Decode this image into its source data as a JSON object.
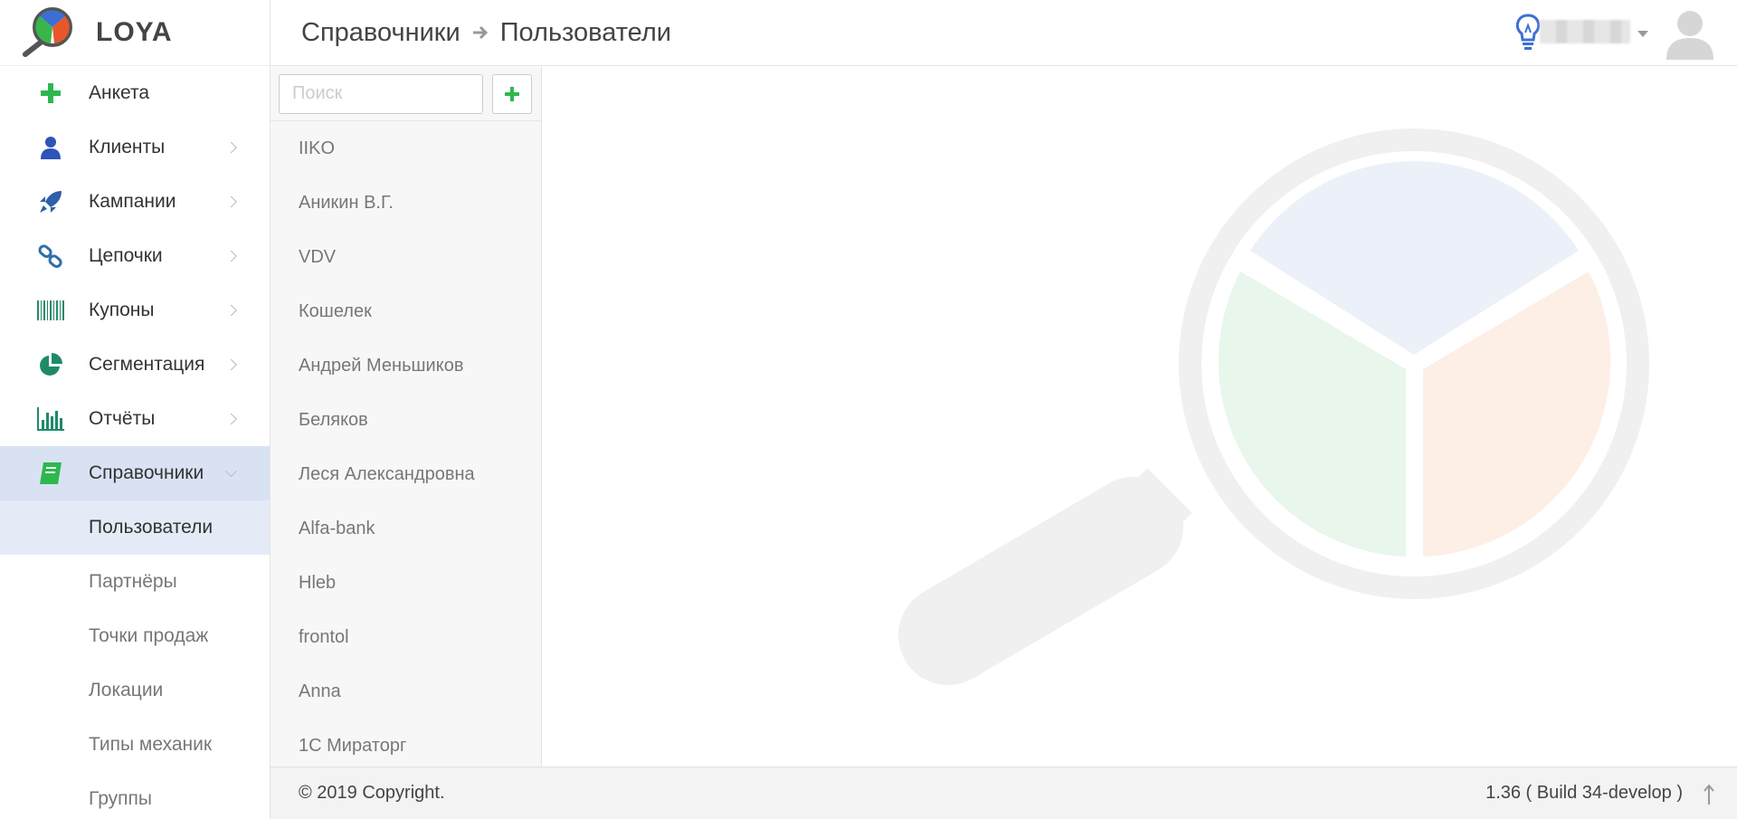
{
  "app": {
    "logo_text": "LOYA"
  },
  "header": {
    "breadcrumb": [
      "Справочники",
      "Пользователи"
    ],
    "icons": [
      "lightbulb-icon",
      "avatar-icon"
    ]
  },
  "sidebar": {
    "items": [
      {
        "label": "Анкета",
        "icon": "plus-icon"
      },
      {
        "label": "Клиенты",
        "icon": "user-icon"
      },
      {
        "label": "Кампании",
        "icon": "rocket-icon"
      },
      {
        "label": "Цепочки",
        "icon": "chain-icon"
      },
      {
        "label": "Купоны",
        "icon": "barcode-icon"
      },
      {
        "label": "Сегментация",
        "icon": "pie-icon"
      },
      {
        "label": "Отчёты",
        "icon": "bar-chart-icon"
      },
      {
        "label": "Справочники",
        "icon": "book-icon"
      }
    ],
    "subitems": [
      "Пользователи",
      "Партнёры",
      "Точки продаж",
      "Локации",
      "Типы механик",
      "Группы"
    ]
  },
  "list": {
    "search_placeholder": "Поиск",
    "items": [
      "IIKO",
      "Аникин В.Г.",
      "VDV",
      "Кошелек",
      "Андрей Меньшиков",
      "Беляков",
      "Леся Александровна",
      "Alfa-bank",
      "Hleb",
      "frontol",
      "Anna",
      "1С Мираторг"
    ]
  },
  "footer": {
    "copyright": "© 2019 Copyright.",
    "version": "1.36 ( Build 34-develop )"
  },
  "colors": {
    "accent_green": "#2db84d",
    "active_bg": "#d9e2f3",
    "sub_active_bg": "#e4ebf7",
    "bulb_blue": "#3d6fd6"
  }
}
